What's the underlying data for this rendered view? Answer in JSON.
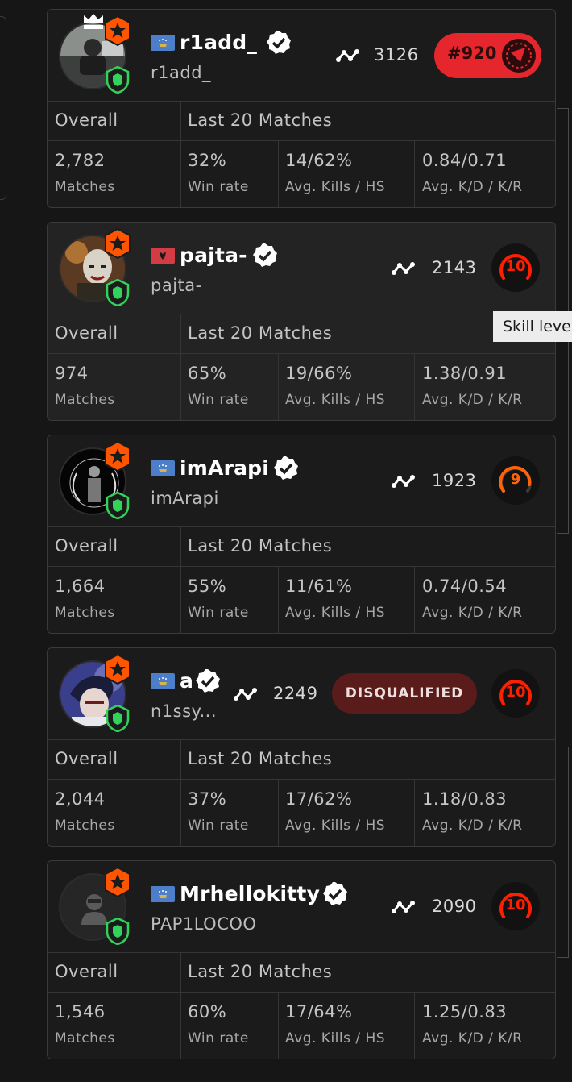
{
  "players": [
    {
      "nickname": "r1add_",
      "username": "r1add_",
      "flag": "kosovo",
      "elo": "3126",
      "rank": "#920",
      "overall_label": "Overall",
      "last20_label": "Last 20 Matches",
      "matches": "2,782",
      "matches_label": "Matches",
      "win_rate": "32%",
      "win_rate_label": "Win rate",
      "kills_hs": "14/62%",
      "kills_hs_label": "Avg. Kills / HS",
      "kd_kr": "0.84/0.71",
      "kd_kr_label": "Avg. K/D / K/R"
    },
    {
      "nickname": "pajta-",
      "username": "pajta-",
      "flag": "albania",
      "elo": "2143",
      "skill_level": "10",
      "overall_label": "Overall",
      "last20_label": "Last 20 Matches",
      "matches": "974",
      "matches_label": "Matches",
      "win_rate": "65%",
      "win_rate_label": "Win rate",
      "kills_hs": "19/66%",
      "kills_hs_label": "Avg. Kills / HS",
      "kd_kr": "1.38/0.91",
      "kd_kr_label": "Avg. K/D / K/R"
    },
    {
      "nickname": "imArapi",
      "username": "imArapi",
      "flag": "kosovo",
      "elo": "1923",
      "skill_level": "9",
      "overall_label": "Overall",
      "last20_label": "Last 20 Matches",
      "matches": "1,664",
      "matches_label": "Matches",
      "win_rate": "55%",
      "win_rate_label": "Win rate",
      "kills_hs": "11/61%",
      "kills_hs_label": "Avg. Kills / HS",
      "kd_kr": "0.74/0.54",
      "kd_kr_label": "Avg. K/D / K/R"
    },
    {
      "nickname": "a",
      "username": "n1ssy...",
      "flag": "kosovo",
      "elo": "2249",
      "status": "DISQUALIFIED",
      "skill_level": "10",
      "overall_label": "Overall",
      "last20_label": "Last 20 Matches",
      "matches": "2,044",
      "matches_label": "Matches",
      "win_rate": "37%",
      "win_rate_label": "Win rate",
      "kills_hs": "17/62%",
      "kills_hs_label": "Avg. Kills / HS",
      "kd_kr": "1.18/0.83",
      "kd_kr_label": "Avg. K/D / K/R"
    },
    {
      "nickname": "Mrhellokitty",
      "username": "PAP1LOCOO",
      "flag": "kosovo",
      "elo": "2090",
      "skill_level": "10",
      "overall_label": "Overall",
      "last20_label": "Last 20 Matches",
      "matches": "1,546",
      "matches_label": "Matches",
      "win_rate": "60%",
      "win_rate_label": "Win rate",
      "kills_hs": "17/64%",
      "kills_hs_label": "Avg. Kills / HS",
      "kd_kr": "1.25/0.83",
      "kd_kr_label": "Avg. K/D / K/R"
    }
  ],
  "tooltip": "Skill level",
  "colors": {
    "lvl10": "#fe1f00",
    "lvl9": "#ff6309",
    "rank_red": "#e5262c",
    "badge_orange": "#ff5500",
    "shield_green": "#32d35a"
  },
  "icons": {
    "verified": "verified-badge-icon",
    "elo": "elo-graph-icon",
    "star_badge": "star-badge-icon",
    "shield_badge": "shield-badge-icon",
    "crown": "crown-icon"
  }
}
